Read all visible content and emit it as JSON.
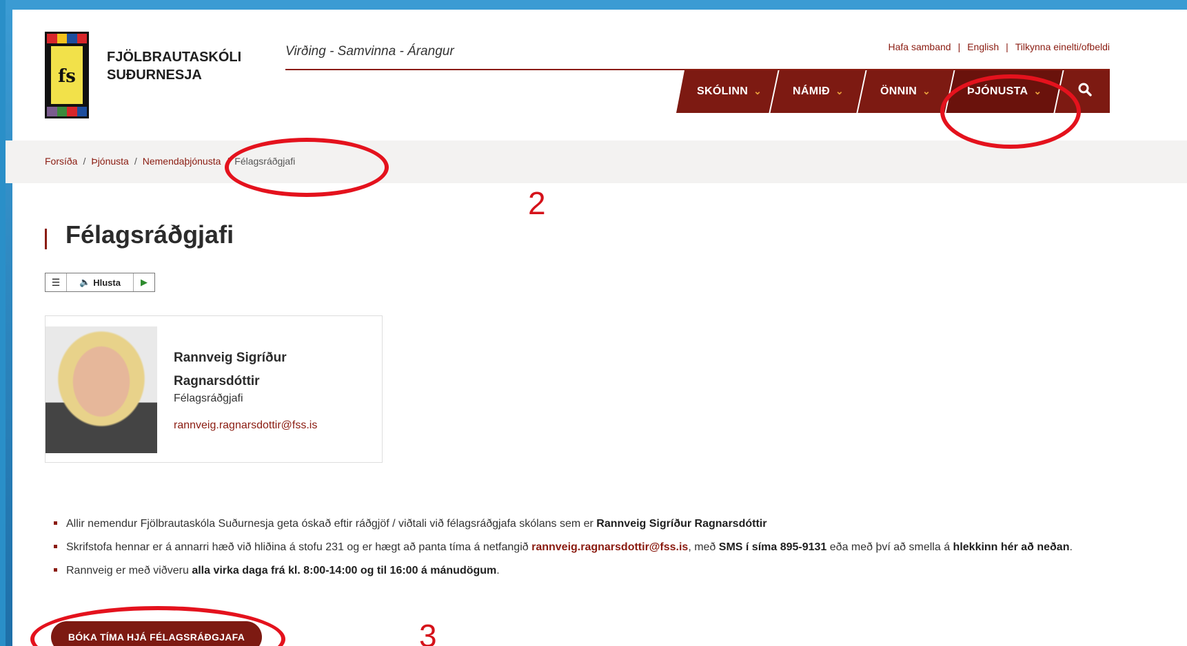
{
  "colors": {
    "brand": "#7d1a12",
    "accent": "#8a1b10",
    "chevron": "#e8a13a",
    "annotation": "#e4121d",
    "frame": "#3b9bd3"
  },
  "header": {
    "logo_text": "fs",
    "school_name_line1": "FJÖLBRAUTASKÓLI",
    "school_name_line2": "SUÐURNESJA",
    "motto": "Virðing - Samvinna - Árangur",
    "toplinks": [
      "Hafa samband",
      "English",
      "Tilkynna einelti/ofbeldi"
    ]
  },
  "nav": {
    "items": [
      {
        "label": "SKÓLINN"
      },
      {
        "label": "NÁMIÐ"
      },
      {
        "label": "ÖNNIN"
      },
      {
        "label": "ÞJÓNUSTA"
      }
    ],
    "chevron_icon": "chevron-down-icon",
    "search_icon": "search-icon"
  },
  "breadcrumb": {
    "items": [
      "Forsíða",
      "Þjónusta",
      "Nemendaþjónusta"
    ],
    "current": "Félagsráðgjafi"
  },
  "page": {
    "title": "Félagsráðgjafi",
    "listen_label": "Hlusta"
  },
  "contact_card": {
    "name": "Rannveig Sigríður Ragnarsdóttir",
    "role": "Félagsráðgjafi",
    "email": "rannveig.ragnarsdottir@fss.is"
  },
  "bullets": {
    "b1_text": "Allir nemendur Fjölbrautaskóla Suðurnesja geta óskað eftir ráðgjöf / viðtali við félagsráðgjafa skólans sem er ",
    "b1_bold": "Rannveig Sigríður Ragnarsdóttir",
    "b2_text1": "Skrifstofa hennar er á annarri hæð við hliðina á stofu 231 og er hægt að panta tíma á netfangið ",
    "b2_link": "rannveig.ragnarsdottir@fss.is",
    "b2_text2": ", með ",
    "b2_bold1": "SMS í síma 895-9131",
    "b2_text3": " eða með því að smella á ",
    "b2_bold2": "hlekkinn hér að neðan",
    "b2_text4": ".",
    "b3_text": "Rannveig er með viðveru ",
    "b3_bold": "alla virka daga frá kl. 8:00-14:00 og til 16:00 á mánudögum",
    "b3_end": "."
  },
  "cta": {
    "label": "BÓKA TÍMA HJÁ FÉLAGSRÁÐGJAFA"
  },
  "annotations": {
    "num2": "2",
    "num3": "3"
  }
}
